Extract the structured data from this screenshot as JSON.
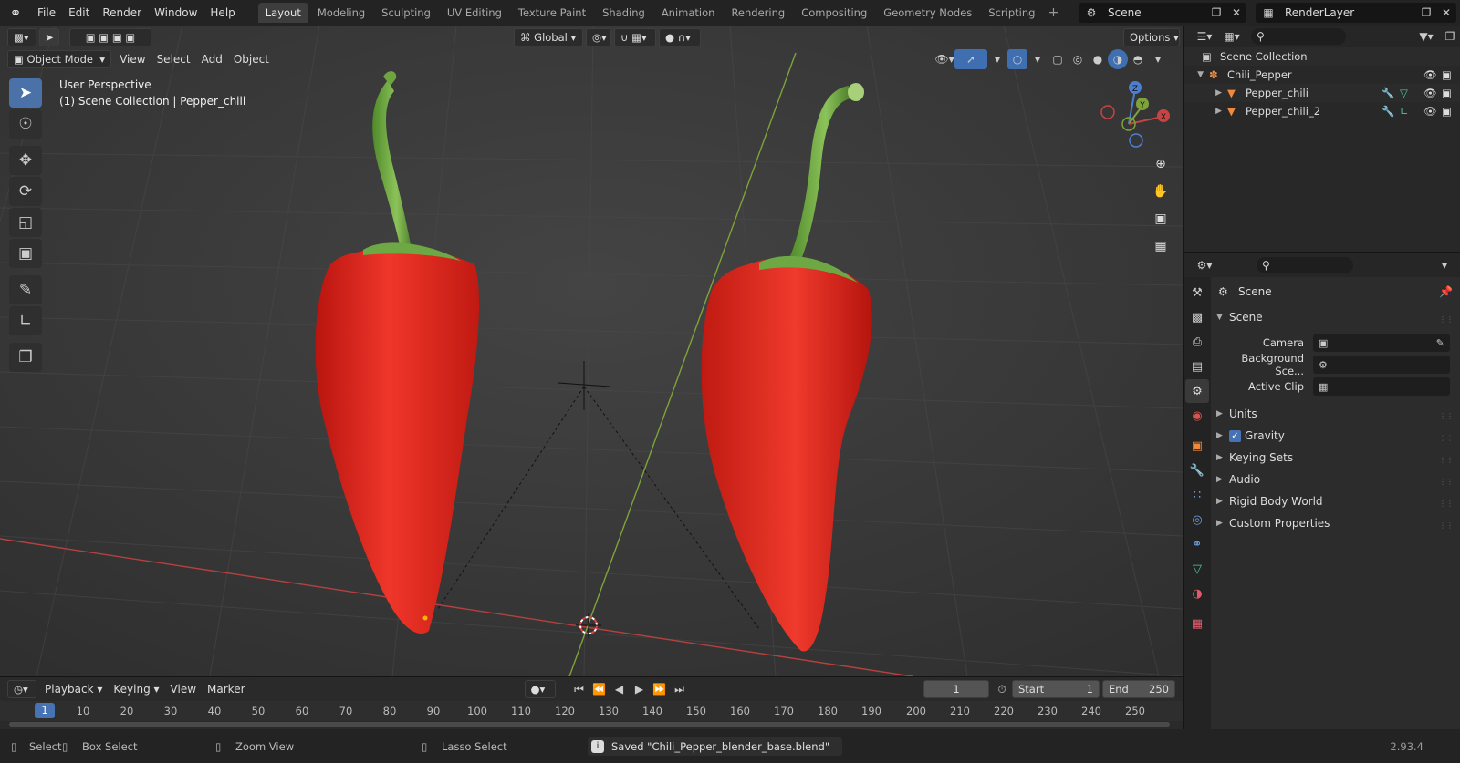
{
  "topbar": {
    "menus": [
      "File",
      "Edit",
      "Render",
      "Window",
      "Help"
    ],
    "workspaces": [
      "Layout",
      "Modeling",
      "Sculpting",
      "UV Editing",
      "Texture Paint",
      "Shading",
      "Animation",
      "Rendering",
      "Compositing",
      "Geometry Nodes",
      "Scripting"
    ],
    "active_workspace": "Layout",
    "scene_name": "Scene",
    "render_layer": "RenderLayer"
  },
  "viewport": {
    "mode": "Object Mode",
    "menus": [
      "View",
      "Select",
      "Add",
      "Object"
    ],
    "transform_orientation": "Global",
    "options_label": "Options",
    "perspective_label": "User Perspective",
    "collection_label": "(1) Scene Collection | Pepper_chili",
    "gizmo_axes": {
      "x": "X",
      "y": "Y",
      "z": "Z"
    }
  },
  "timeline": {
    "menus": [
      "Playback",
      "Keying",
      "View",
      "Marker"
    ],
    "current_frame": "1",
    "start_label": "Start",
    "start_value": "1",
    "end_label": "End",
    "end_value": "250",
    "ruler": [
      "10",
      "20",
      "30",
      "40",
      "50",
      "60",
      "70",
      "80",
      "90",
      "100",
      "110",
      "120",
      "130",
      "140",
      "150",
      "160",
      "170",
      "180",
      "190",
      "200",
      "210",
      "220",
      "230",
      "240",
      "250"
    ],
    "ruler_current": "1"
  },
  "statusbar": {
    "select": "Select",
    "box_select": "Box Select",
    "zoom_view": "Zoom View",
    "lasso_select": "Lasso Select",
    "message": "Saved \"Chili_Pepper_blender_base.blend\"",
    "version": "2.93.4"
  },
  "outliner": {
    "root": "Scene Collection",
    "collection": "Chili_Pepper",
    "objects": [
      "Pepper_chili",
      "Pepper_chili_2"
    ]
  },
  "properties": {
    "header": "Scene",
    "section": "Scene",
    "camera_label": "Camera",
    "background_label": "Background Sce...",
    "active_clip_label": "Active Clip",
    "panels": [
      "Units",
      "Gravity",
      "Keying Sets",
      "Audio",
      "Rigid Body World",
      "Custom Properties"
    ],
    "gravity_checked": true
  },
  "colors": {
    "accent": "#4772b3",
    "viewport_bg": "#3a3a3a",
    "pepper_red": "#e0261e",
    "stem_green": "#6aa53a",
    "x_axis": "#c74445",
    "y_axis": "#7ea33a"
  }
}
